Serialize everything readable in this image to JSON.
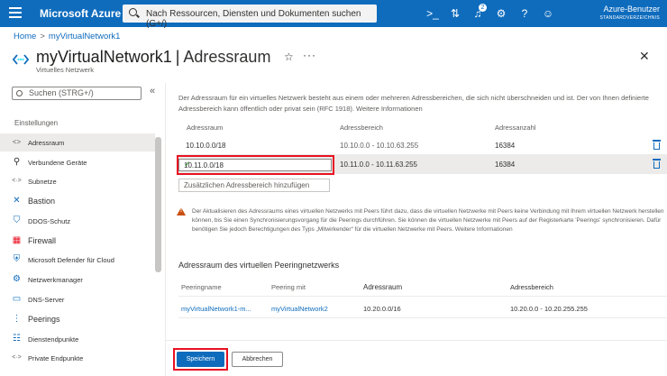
{
  "topbar": {
    "brand": "Microsoft Azure",
    "search_placeholder": "Nach Ressourcen, Diensten und Dokumenten suchen (G+/)",
    "notification_count": "2",
    "user_name": "Azure-Benutzer",
    "user_directory": "STANDARDVERZEICHNIS"
  },
  "breadcrumb": {
    "home": "Home",
    "sep": ">",
    "resource": "myVirtualNetwork1"
  },
  "header": {
    "resource_name": "myVirtualNetwork1",
    "divider": "|",
    "blade_title": "Adressraum",
    "resource_type": "Virtuelles Netzwerk",
    "more": "···",
    "star": "☆",
    "close": "✕"
  },
  "sidebar": {
    "search_placeholder": "Suchen (STRG+/)",
    "collapse": "«",
    "section": "Einstellungen",
    "items": [
      {
        "label": "Adressraum",
        "icon": "<>"
      },
      {
        "label": "Verbundene Geräte",
        "icon": "plug-icon"
      },
      {
        "label": "Subnetze",
        "icon": "<·>"
      },
      {
        "label": "Bastion",
        "icon": "bastion-icon"
      },
      {
        "label": "DDOS-Schutz",
        "icon": "shield-icon"
      },
      {
        "label": "Firewall",
        "icon": "firewall-icon"
      },
      {
        "label": "Microsoft Defender für Cloud",
        "icon": "defender-icon"
      },
      {
        "label": "Netzwerkmanager",
        "icon": "network-manager-icon"
      },
      {
        "label": "DNS-Server",
        "icon": "dns-icon"
      },
      {
        "label": "Peerings",
        "icon": "peerings-icon"
      },
      {
        "label": "Dienstendpunkte",
        "icon": "service-endpoint-icon"
      },
      {
        "label": "Private Endpunkte",
        "icon": "<·>"
      }
    ]
  },
  "main": {
    "description": "Der Adressraum für ein virtuelles Netzwerk besteht aus einem oder mehreren Adressbereichen, die sich nicht überschneiden und ist. Der von Ihnen definierte Adressbereich kann öffentlich oder privat sein (RFC 1918). Weitere Informationen",
    "columns": [
      "Adressraum",
      "Adressbereich",
      "Adressanzahl"
    ],
    "rows": [
      {
        "space": "10.10.0.0/18",
        "range": "10.10.0.0 - 10.10.63.255",
        "count": "16384"
      },
      {
        "space": "10.11.0.0/18",
        "range": "10.11.0.0 - 10.11.63.255",
        "count": "16384"
      }
    ],
    "add_placeholder": "Zusätzlichen Adressbereich hinzufügen",
    "warning": "Der Aktualisieren des Adressraums eines virtuellen Netzwerks mit Peers führt dazu, dass die virtuellen Netzwerke mit Peers keine Verbindung mit Ihrem virtuellen Netzwerk herstellen können, bis Sie einen Synchronisierungsvorgang für die Peerings durchführen. Sie können die virtuellen Netzwerke mit Peers auf der Registerkarte 'Peerings' synchronisieren. Dafür benötigen Sie jedoch Berechtigungen des Typs „Mitwirkender“ für die virtuellen Netzwerke mit Peers. Weitere Informationen",
    "peer_title": "Adressraum des virtuellen Peeringnetzwerks",
    "peer_columns": [
      "Peeringname",
      "Peering mit",
      "Adressraum",
      "Adressbereich"
    ],
    "peer_rows": [
      {
        "name": "myVirtualNetwork1-m...",
        "with": "myVirtualNetwork2",
        "space": "10.20.0.0/16",
        "range": "10.20.0.0 - 10.20.255.255"
      }
    ]
  },
  "footer": {
    "save": "Speichern",
    "cancel": "Abbrechen"
  },
  "colors": {
    "accent": "#0f6cbd",
    "highlight": "#e81123",
    "success": "#107c10",
    "warning": "#ca5010"
  }
}
